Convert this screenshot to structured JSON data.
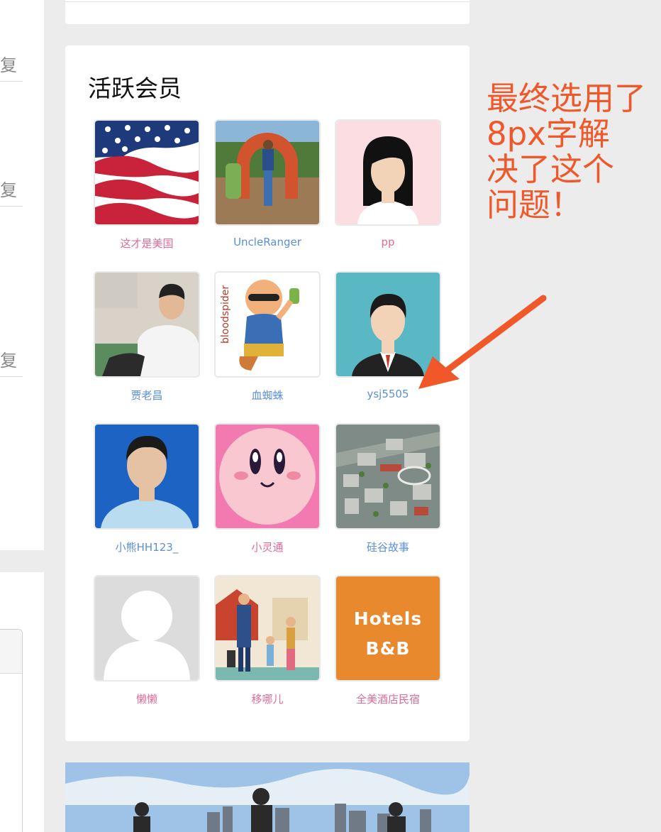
{
  "left_column": {
    "reply_labels": [
      "复",
      "复",
      "复"
    ]
  },
  "members_widget": {
    "title": "活跃会员",
    "members": [
      {
        "name": "这才是美国",
        "avatar": "us-flag-avatar",
        "name_color": "#e06a9a"
      },
      {
        "name": "UncleRanger",
        "avatar": "android-sculpture-photo",
        "name_color": "#5b8fd6"
      },
      {
        "name": "pp",
        "avatar": "female-default-avatar",
        "name_color": "#e06a9a"
      },
      {
        "name": "贾老昌",
        "avatar": "man-selfie-photo",
        "name_color": "#5b8fd6"
      },
      {
        "name": "血蜘蛛",
        "avatar": "bloodspider-cartoon",
        "name_color": "#5b8fd6"
      },
      {
        "name": "ysj5505",
        "avatar": "male-default-avatar",
        "name_color": "#5b8fd6"
      },
      {
        "name": "小熊HH123_",
        "avatar": "id-photo",
        "name_color": "#5b8fd6"
      },
      {
        "name": "小灵通",
        "avatar": "kirby-face",
        "name_color": "#e06a9a"
      },
      {
        "name": "硅谷故事",
        "avatar": "city-aerial-photo",
        "name_color": "#5b8fd6"
      },
      {
        "name": "懒懒",
        "avatar": "placeholder-silhouette",
        "name_color": "#e06a9a"
      },
      {
        "name": "移哪儿",
        "avatar": "travelers-illustration",
        "name_color": "#e06a9a"
      },
      {
        "name": "全美酒店民宿",
        "avatar": "hotels-bnb-logo",
        "name_color": "#e06a9a"
      }
    ],
    "hotels_logo_text": [
      "Hotels",
      "B&B"
    ],
    "bloodspider_text": "bloodspider"
  },
  "annotation": {
    "lines": [
      "最终选用了",
      "8px字解",
      "决了这个",
      "问题！"
    ],
    "color": "#f0582a"
  }
}
